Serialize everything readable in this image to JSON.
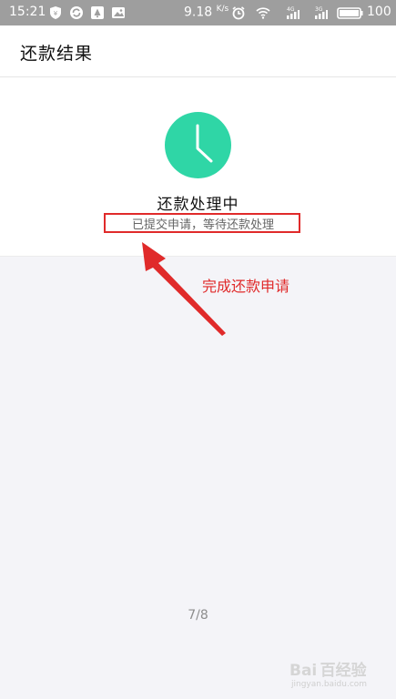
{
  "status_bar": {
    "time": "15:21",
    "net_speed": "9.18",
    "net_speed_unit": "K/s",
    "signal_badge_1": "4G",
    "signal_badge_2": "3G",
    "battery_level": "100",
    "icons": [
      "shield-icon",
      "sync-icon",
      "notification-icon",
      "image-icon",
      "alarm-icon",
      "wifi-icon",
      "signal-icon",
      "signal-icon",
      "battery-icon"
    ]
  },
  "header": {
    "title": "还款结果"
  },
  "result": {
    "icon": "clock-icon",
    "icon_color": "#2fd6a6",
    "title": "还款处理中",
    "subtitle": "已提交申请，等待还款处理"
  },
  "annotation": {
    "text": "完成还款申请",
    "color": "#e02a2a"
  },
  "page_indicator": "7/8",
  "watermark": {
    "logo": "Bai 百经验",
    "url": "jingyan.baidu.com"
  }
}
